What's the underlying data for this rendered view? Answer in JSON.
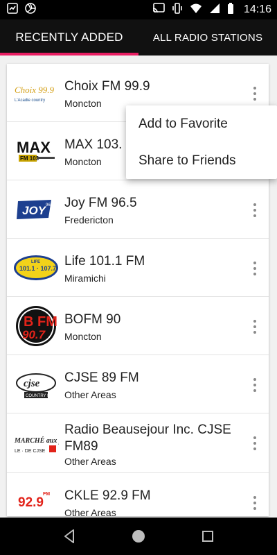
{
  "status_bar": {
    "time": "14:16",
    "left_icons": [
      "notification-icon",
      "aperture-icon"
    ],
    "right_icons": [
      "cast-icon",
      "vibrate-icon",
      "wifi-icon",
      "signal-icon",
      "battery-icon"
    ]
  },
  "tabs": [
    {
      "label": "RECENTLY ADDED",
      "selected": true
    },
    {
      "label": "ALL RADIO STATIONS",
      "selected": false
    }
  ],
  "accent_color": "#e91e63",
  "stations": [
    {
      "name": "Choix FM 99.9",
      "location": "Moncton",
      "logo_text": "Choix 99.9",
      "logo_sub": "L'Acadie country"
    },
    {
      "name": "MAX 103.",
      "location": "Moncton",
      "logo_text": "MAX",
      "logo_sub": "FM 103"
    },
    {
      "name": "Joy FM 96.5",
      "location": "Fredericton",
      "logo_text": "JOY",
      "logo_sub": "96.5"
    },
    {
      "name": "Life 101.1 FM",
      "location": "Miramichi",
      "logo_text": "101.1 · 107.7",
      "logo_sub": "LIFE"
    },
    {
      "name": "BOFM 90",
      "location": "Moncton",
      "logo_text": "90.7",
      "logo_sub": "B FM"
    },
    {
      "name": "CJSE 89 FM",
      "location": "Other Areas",
      "logo_text": "cjse",
      "logo_sub": "COUNTRY 89"
    },
    {
      "name": "Radio Beausejour Inc. CJSE FM89",
      "location": "Other Areas",
      "logo_text": "MARCHÉ aux puces",
      "logo_sub": "LE · DE CJSE"
    },
    {
      "name": "CKLE 92.9 FM",
      "location": "Other Areas",
      "logo_text": "92.9",
      "logo_sub": "FM"
    }
  ],
  "popup_menu": {
    "items": [
      "Add to Favorite",
      "Share to Friends"
    ]
  },
  "nav_bar": {
    "icons": [
      "back-icon",
      "home-icon",
      "recents-icon"
    ]
  }
}
